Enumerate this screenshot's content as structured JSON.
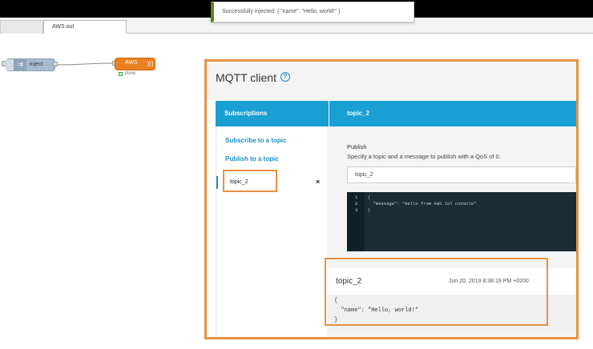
{
  "toast": {
    "message": "Successfully injected: { \"name\": \"Hello, world!\" }"
  },
  "tabs": [
    {
      "label": ""
    },
    {
      "label": "AWS out"
    }
  ],
  "flow": {
    "inject_node": {
      "label": "inject"
    },
    "aws_node": {
      "label": "AWS",
      "status": "done"
    }
  },
  "console": {
    "title": "MQTT client",
    "subscriptions": {
      "header": "Subscriptions",
      "links": [
        "Subscribe to a topic",
        "Publish to a topic"
      ],
      "topic": "topic_2",
      "close": "×"
    },
    "publish_panel": {
      "header": "topic_2",
      "title": "Publish",
      "description": "Specify a topic and a message to publish with a QoS of 0.",
      "topic_value": "topic_2",
      "editor_lines": [
        {
          "n": "1",
          "text": "{"
        },
        {
          "n": "2",
          "text": "  \"message\": \"Hello from AWS IoT console\""
        },
        {
          "n": "3",
          "text": "}"
        }
      ]
    },
    "message": {
      "topic": "topic_2",
      "time": "Jun 20, 2019 8:38:19 PM +0200",
      "lines": [
        "{",
        "  \"name\": \"Hello, world!\"",
        "}"
      ]
    }
  },
  "colors": {
    "accent_orange": "#e8913f",
    "aws_blue": "#1a9fd3",
    "node_orange": "#e8811f",
    "inject_blue": "#a6bbcf"
  }
}
